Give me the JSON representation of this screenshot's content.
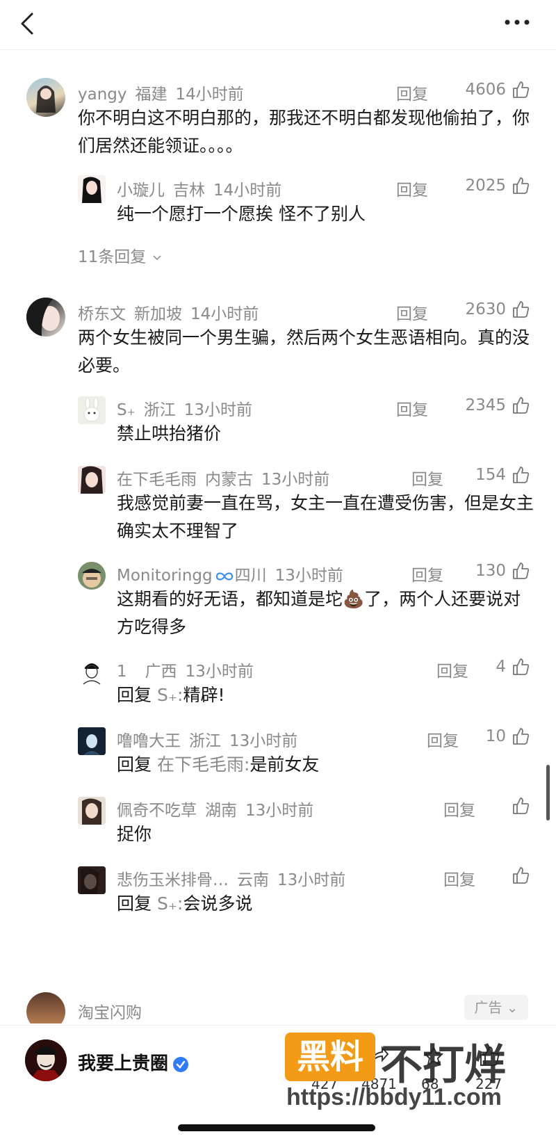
{
  "header": {
    "back_icon": "chevron-left-icon",
    "more_icon": "ellipsis-icon"
  },
  "comments": [
    {
      "user": "yangy",
      "location": "福建",
      "time": "14小时前",
      "reply_label": "回复",
      "likes": "4606",
      "text": "你不明白这不明白那的，那我还不明白都发现他偷拍了，你们居然还能领证。。。。",
      "replies": [
        {
          "user": "小璇儿",
          "location": "吉林",
          "time": "14小时前",
          "reply_label": "回复",
          "likes": "2025",
          "text": "纯一个愿打一个愿挨 怪不了别人"
        }
      ],
      "more_replies": "11条回复"
    },
    {
      "user": "桥东文",
      "location": "新加坡",
      "time": "14小时前",
      "reply_label": "回复",
      "likes": "2630",
      "text": "两个女生被同一个男生骗，然后两个女生恶语相向。真的没必要。",
      "replies": [
        {
          "user": "S₊",
          "location": "浙江",
          "time": "13小时前",
          "reply_label": "回复",
          "likes": "2345",
          "text": "禁止哄抬猪价"
        },
        {
          "user": "在下毛毛雨",
          "location": "内蒙古",
          "time": "13小时前",
          "reply_label": "回复",
          "likes": "154",
          "text": "我感觉前妻一直在骂，女主一直在遭受伤害，但是女主确实太不理智了"
        },
        {
          "user": "Monitoringg",
          "location": "四川",
          "time": "13小时前",
          "reply_label": "回复",
          "likes": "130",
          "text_a": "这期看的好无语，都知道是坨",
          "emoji": "💩",
          "text_b": "了，两个人还要说对方吃得多"
        },
        {
          "user": "1",
          "location": "广西",
          "time": "13小时前",
          "reply_label": "回复",
          "likes": "4",
          "prefix": "回复",
          "mention": "S₊:",
          "text": "精辟!"
        },
        {
          "user": "噜噜大王",
          "location": "浙江",
          "time": "13小时前",
          "reply_label": "回复",
          "likes": "10",
          "prefix": "回复",
          "mention": "在下毛毛雨:",
          "text": "是前女友"
        },
        {
          "user": "佩奇不吃草",
          "location": "湖南",
          "time": "13小时前",
          "reply_label": "回复",
          "likes": "",
          "text": "捉你"
        },
        {
          "user": "悲伤玉米排骨…",
          "location": "云南",
          "time": "13小时前",
          "reply_label": "回复",
          "likes": "",
          "prefix": "回复",
          "mention": "S₊:",
          "text": "会说多说"
        }
      ]
    }
  ],
  "ad": {
    "name": "淘宝闪购",
    "tag": "广告"
  },
  "footer": {
    "author": "我要上贵圈",
    "stats": [
      "427",
      "4871",
      "68",
      "227"
    ],
    "watermark_box": "黑料",
    "watermark_text": "不打烊",
    "watermark_url": "https://bbdy11.com"
  },
  "colors": {
    "meta": "#8a8a8a",
    "text": "#1a1a1a",
    "watermark": "#f39a17",
    "verify": "#2f7cf6"
  }
}
